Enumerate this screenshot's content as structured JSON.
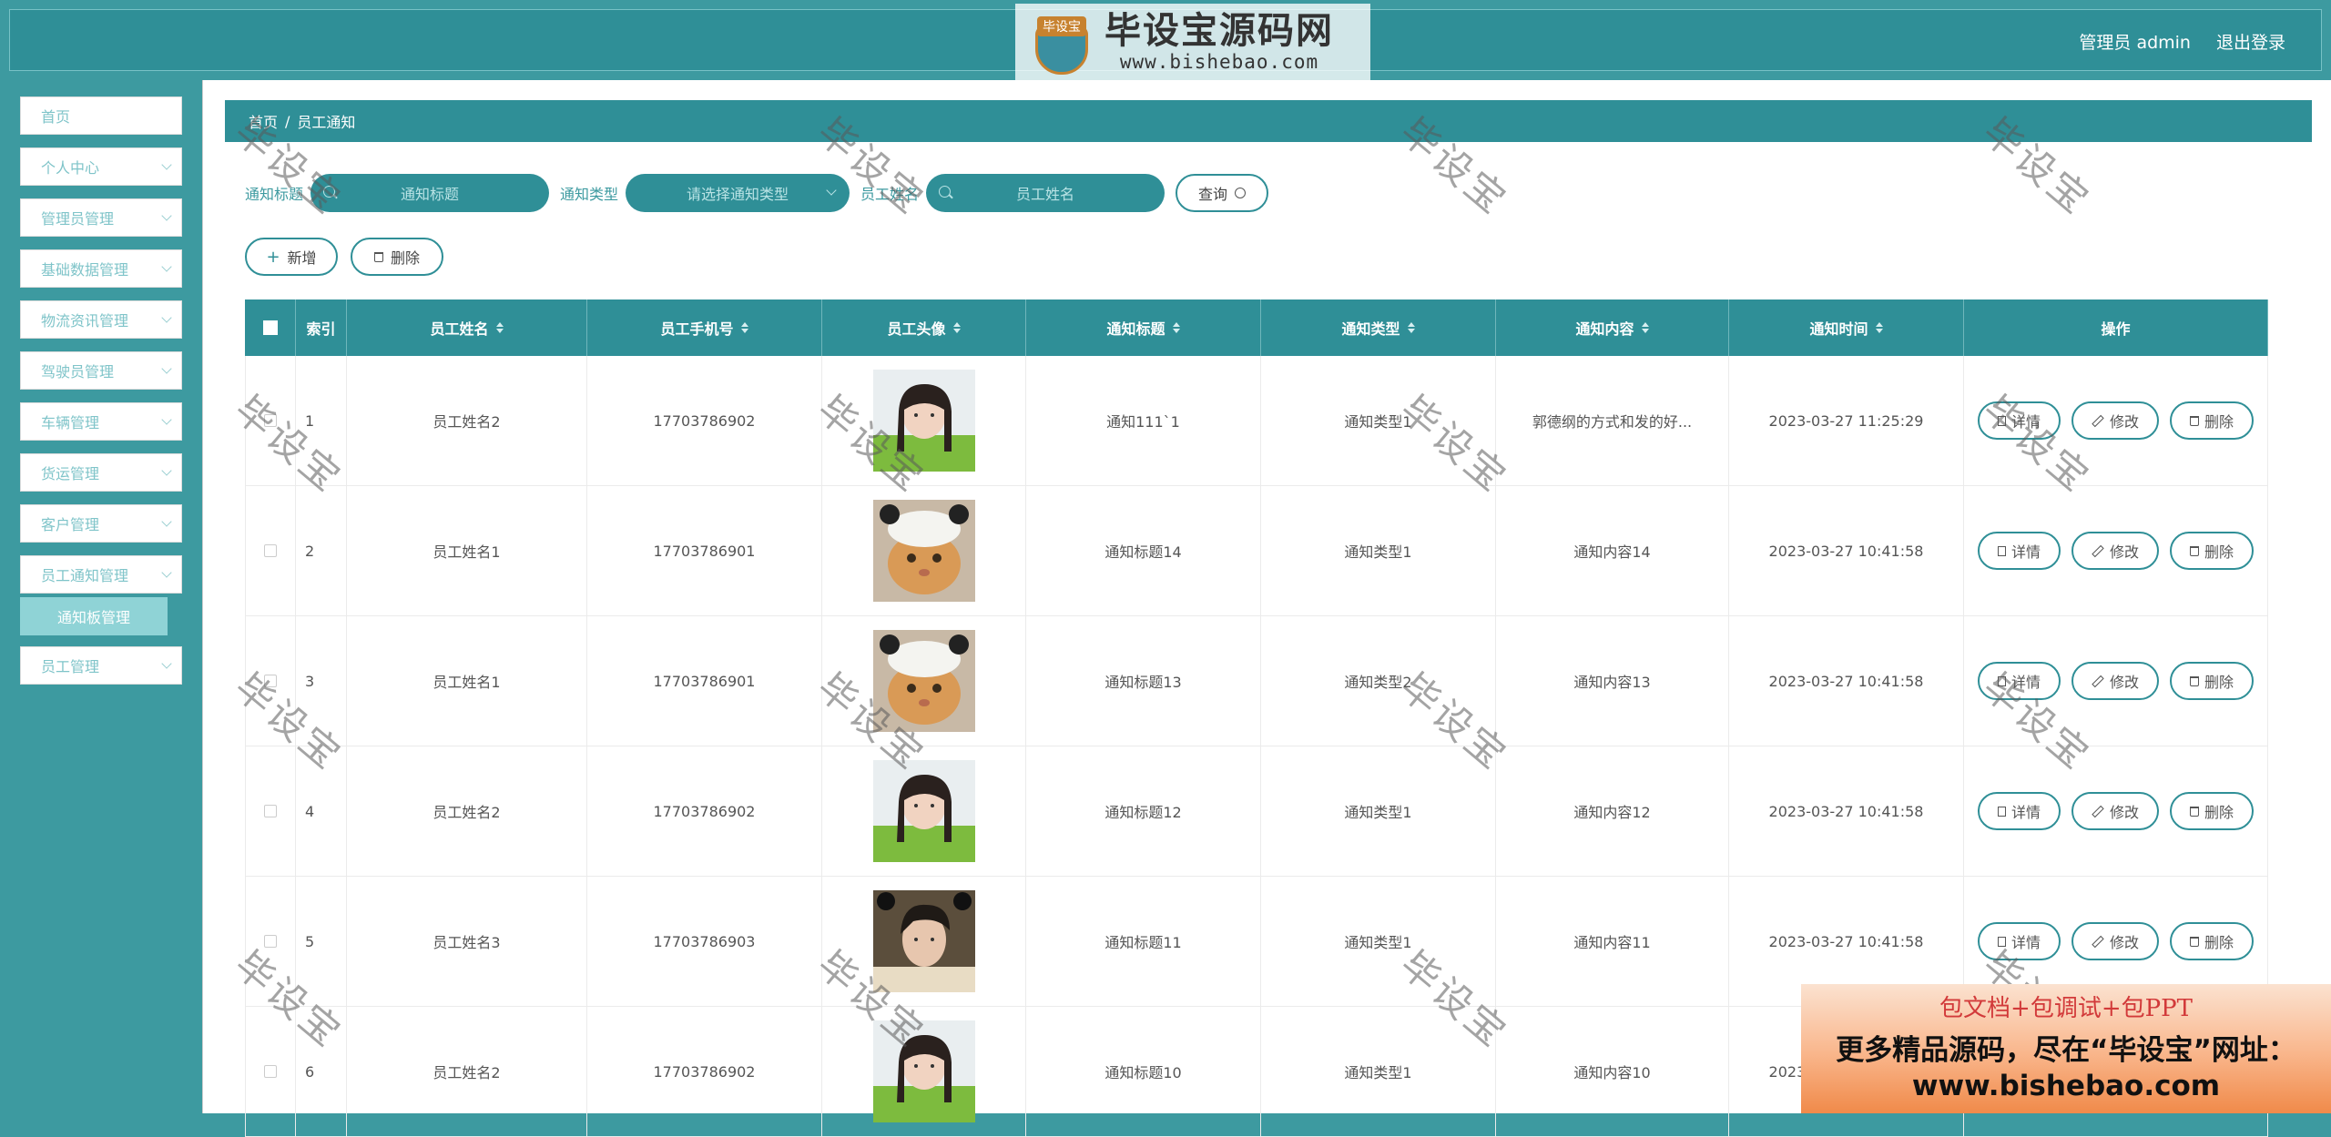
{
  "header": {
    "user_label": "管理员 admin",
    "logout_label": "退出登录",
    "logo_tag": "毕设宝",
    "logo_title": "毕设宝源码网",
    "logo_url": "www.bishebao.com"
  },
  "sidebar": {
    "items": [
      {
        "label": "首页"
      },
      {
        "label": "个人中心"
      },
      {
        "label": "管理员管理"
      },
      {
        "label": "基础数据管理"
      },
      {
        "label": "物流资讯管理"
      },
      {
        "label": "驾驶员管理"
      },
      {
        "label": "车辆管理"
      },
      {
        "label": "货运管理"
      },
      {
        "label": "客户管理"
      },
      {
        "label": "员工通知管理"
      },
      {
        "label": "员工管理"
      }
    ],
    "active_sub": "通知板管理"
  },
  "breadcrumb": {
    "home": "首页",
    "sep": "/",
    "current": "员工通知"
  },
  "filters": {
    "title_label": "通知标题",
    "title_placeholder": "通知标题",
    "type_label": "通知类型",
    "type_placeholder": "请选择通知类型",
    "name_label": "员工姓名",
    "name_placeholder": "员工姓名",
    "query_label": "查询"
  },
  "toolbar": {
    "add_label": "新增",
    "delete_label": "删除"
  },
  "table": {
    "headers": [
      "索引",
      "员工姓名",
      "员工手机号",
      "员工头像",
      "通知标题",
      "通知类型",
      "通知内容",
      "通知时间",
      "操作"
    ],
    "ops": {
      "detail": "详情",
      "edit": "修改",
      "delete": "删除"
    },
    "rows": [
      {
        "index": "1",
        "name": "员工姓名2",
        "phone": "17703786902",
        "avatar": "girl",
        "title": "通知111`1",
        "type": "通知类型1",
        "content": "郭德纲的方式和发的好...",
        "time": "2023-03-27 11:25:29"
      },
      {
        "index": "2",
        "name": "员工姓名1",
        "phone": "17703786901",
        "avatar": "cat",
        "title": "通知标题14",
        "type": "通知类型1",
        "content": "通知内容14",
        "time": "2023-03-27 10:41:58"
      },
      {
        "index": "3",
        "name": "员工姓名1",
        "phone": "17703786901",
        "avatar": "cat",
        "title": "通知标题13",
        "type": "通知类型2",
        "content": "通知内容13",
        "time": "2023-03-27 10:41:58"
      },
      {
        "index": "4",
        "name": "员工姓名2",
        "phone": "17703786902",
        "avatar": "girl",
        "title": "通知标题12",
        "type": "通知类型1",
        "content": "通知内容12",
        "time": "2023-03-27 10:41:58"
      },
      {
        "index": "5",
        "name": "员工姓名3",
        "phone": "17703786903",
        "avatar": "boy",
        "title": "通知标题11",
        "type": "通知类型1",
        "content": "通知内容11",
        "time": "2023-03-27 10:41:58"
      },
      {
        "index": "6",
        "name": "员工姓名2",
        "phone": "17703786902",
        "avatar": "girl",
        "title": "通知标题10",
        "type": "通知类型1",
        "content": "通知内容10",
        "time": "2023-03-27 10:41:58"
      }
    ]
  },
  "watermark": {
    "text": "毕设宝"
  },
  "promo": {
    "line1": "包文档+包调试+包PPT",
    "line2": "更多精品源码，尽在“毕设宝”网址：",
    "line3": "www.bishebao.com"
  },
  "colors": {
    "primary": "#2f8f97",
    "sidebar_bg": "#3d9aa0",
    "menu_text": "#7fc4c9",
    "submenu_active": "#8fd3d6"
  }
}
